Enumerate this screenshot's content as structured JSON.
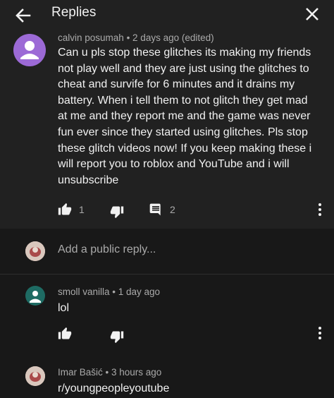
{
  "header": {
    "title": "Replies"
  },
  "main_comment": {
    "author": "calvin posumah",
    "time": "2 days ago (edited)",
    "lines": [
      "Can u pls stop these glitches its making my friends",
      "not play well and they are just using the glitches to",
      "cheat and survife for 6 minutes and it drains my",
      "battery. When i tell them to not glitch they get mad",
      "at me and they report me and the game was never",
      "fun ever since they started using glitches. Pls stop",
      "these glitch videos now! If you keep making these i",
      "will report you to roblox and YouTube and i will",
      "unsubscribe"
    ],
    "likes": "1",
    "replies": "2"
  },
  "reply_box": {
    "placeholder": "Add a public reply..."
  },
  "replies": [
    {
      "author": "smoll vanilla",
      "time": "1 day ago",
      "text": "lol"
    },
    {
      "author": "Imar Bašić",
      "time": "3 hours ago",
      "text": "r/youngpeopleyoutube"
    }
  ],
  "separator": " • ",
  "colors": {
    "background": "#181818",
    "comment_bg": "#212121",
    "avatar_purple": "#9c6ad6",
    "avatar_teal": "#1e6b63",
    "text_primary": "#f1f1f1",
    "text_secondary": "#aaaaaa"
  }
}
